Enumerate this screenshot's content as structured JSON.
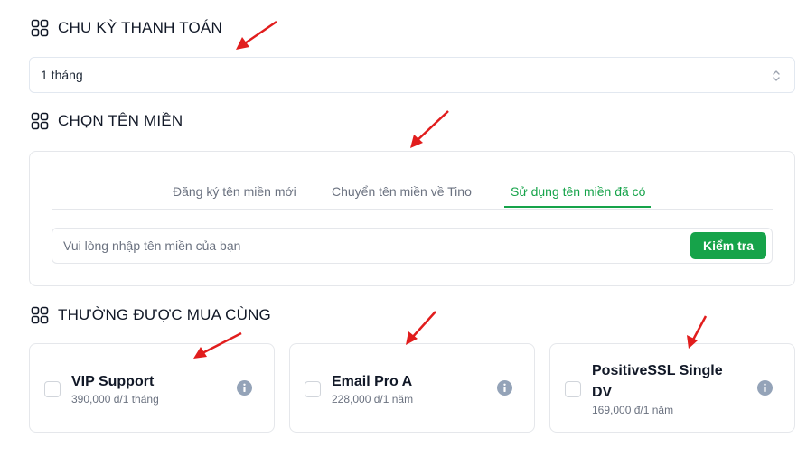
{
  "billing": {
    "heading": "CHU KỲ THANH TOÁN",
    "selected_value": "1 tháng"
  },
  "domain": {
    "heading": "CHỌN TÊN MIỀN",
    "tabs": [
      {
        "label": "Đăng ký tên miền mới",
        "active": false
      },
      {
        "label": "Chuyển tên miền về Tino",
        "active": false
      },
      {
        "label": "Sử dụng tên miền đã có",
        "active": true
      }
    ],
    "input_placeholder": "Vui lòng nhập tên miền của bạn",
    "input_value": "",
    "check_button": "Kiểm tra"
  },
  "addons": {
    "heading": "THƯỜNG ĐƯỢC MUA CÙNG",
    "items": [
      {
        "name": "VIP Support",
        "price": "390,000 đ/1 tháng",
        "checked": false
      },
      {
        "name": "Email Pro A",
        "price": "228,000 đ/1 năm",
        "checked": false
      },
      {
        "name": "PositiveSSL Single DV",
        "price": "169,000 đ/1 năm",
        "checked": false
      }
    ]
  },
  "colors": {
    "accent": "#16a34a",
    "annotation_arrow": "#e11d1d",
    "info_icon": "#94a3b8"
  },
  "icons": {
    "section": "grid-icon",
    "select": "chevron-up-down-icon",
    "addon_info": "info-icon"
  }
}
